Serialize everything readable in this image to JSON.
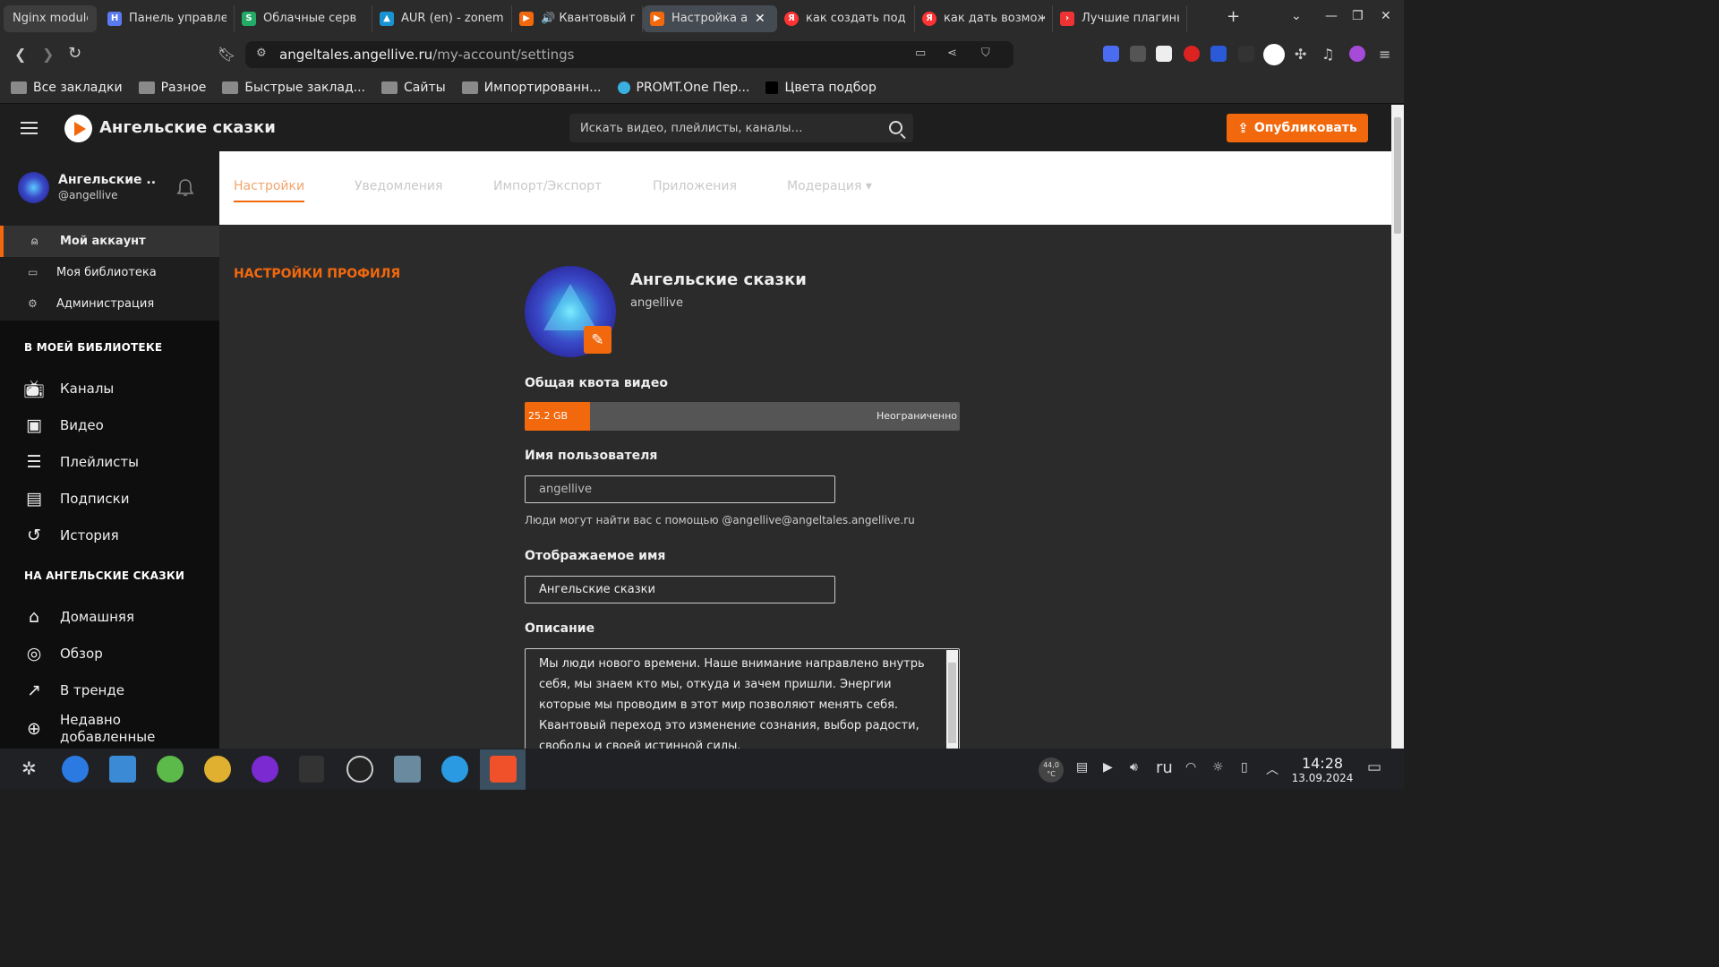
{
  "browser": {
    "tabs": [
      {
        "label": "Nginx module",
        "icon": "none",
        "color": "#3d3d3d"
      },
      {
        "label": "Панель управле",
        "icon": "h-icon",
        "color": "#5a7af0"
      },
      {
        "label": "Облачные серв",
        "icon": "s-icon",
        "color": "#22aa66"
      },
      {
        "label": "AUR (en) - zonem",
        "icon": "arch-icon",
        "color": "#1793d1"
      },
      {
        "label": "🔊 Квантовый п",
        "icon": "peertube-icon",
        "color": "#f1680d"
      },
      {
        "label": "Настройка а",
        "icon": "peertube-icon",
        "color": "#f1680d"
      },
      {
        "label": "как создать под",
        "icon": "yandex-icon",
        "color": "#f33"
      },
      {
        "label": "как дать возмож",
        "icon": "yandex-icon",
        "color": "#f33"
      },
      {
        "label": "Лучшие плагины",
        "icon": "red-arrow-icon",
        "color": "#e33"
      }
    ],
    "url_host": "angeltales.angellive.ru",
    "url_path": "/my-account/settings",
    "bookmarks": [
      "Все закладки",
      "Разное",
      "Быстрые заклад...",
      "Сайты",
      "Импортированн...",
      "PROMT.One Пер...",
      "Цвета подбор"
    ]
  },
  "app": {
    "brand": "Ангельские сказки",
    "search_placeholder": "Искать видео, плейлисты, каналы…",
    "publish_label": "Опубликовать",
    "accent": "#f1680d"
  },
  "sidebar": {
    "user_name": "Ангельские ...",
    "user_handle": "@angellive",
    "account_items": [
      {
        "label": "Мой аккаунт",
        "icon": "user-icon",
        "selected": true
      },
      {
        "label": "Моя библиотека",
        "icon": "tv-icon",
        "selected": false
      },
      {
        "label": "Администрация",
        "icon": "gear-icon",
        "selected": false
      }
    ],
    "library_header": "В МОЕЙ БИБЛИОТЕКЕ",
    "library_items": [
      {
        "label": "Каналы",
        "icon": "tv-icon"
      },
      {
        "label": "Видео",
        "icon": "video-icon"
      },
      {
        "label": "Плейлисты",
        "icon": "list-icon"
      },
      {
        "label": "Подписки",
        "icon": "subscriptions-icon"
      },
      {
        "label": "История",
        "icon": "history-icon"
      }
    ],
    "site_header": "НА АНГЕЛЬСКИЕ СКАЗКИ",
    "site_items": [
      {
        "label": "Домашняя",
        "icon": "home-icon"
      },
      {
        "label": "Обзор",
        "icon": "globe-icon"
      },
      {
        "label": "В тренде",
        "icon": "trending-icon"
      },
      {
        "label": "Недавно добавленные",
        "icon": "plus-circle-icon"
      }
    ]
  },
  "main": {
    "subnav": [
      {
        "label": "Настройки",
        "selected": true
      },
      {
        "label": "Уведомления",
        "selected": false
      },
      {
        "label": "Импорт/Экспорт",
        "selected": false
      },
      {
        "label": "Приложения",
        "selected": false
      },
      {
        "label": "Модерация ▾",
        "selected": false
      }
    ],
    "section_title": "НАСТРОЙКИ ПРОФИЛЯ",
    "display_name": "Ангельские сказки",
    "handle": "angellive",
    "quota_label": "Общая квота видео",
    "quota_used": "25.2 GB",
    "quota_max": "Неограниченно",
    "quota_fill_fraction": 0.15,
    "username_label": "Имя пользователя",
    "username_value": "angellive",
    "username_hint": "Люди могут найти вас с помощью @angellive@angeltales.angellive.ru",
    "displayname_label": "Отображаемое имя",
    "displayname_value": "Ангельские сказки",
    "description_label": "Описание",
    "description_value": "Мы люди нового времени. Наше внимание направлено внутрь себя, мы знаем кто мы, откуда и зачем пришли. Энергии которые мы проводим в этот мир позволяют менять себя. Квантовый переход это изменение сознания, выбор радости, свободы и своей истинной силы."
  },
  "taskbar": {
    "temp": "44,0 °C",
    "lang": "ru",
    "time": "14:28",
    "date": "13.09.2024"
  }
}
